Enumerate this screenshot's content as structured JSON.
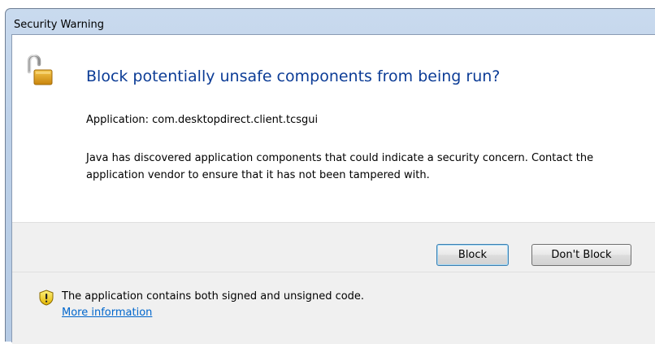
{
  "window": {
    "title": "Security Warning"
  },
  "main": {
    "heading": "Block potentially unsafe components from being run?",
    "application_line": "Application: com.desktopdirect.client.tcsgui",
    "description": "Java has discovered application components that could indicate a security concern. Contact the application vendor to ensure that it has not been tampered with."
  },
  "buttons": {
    "block_label": "Block",
    "dont_block_label": "Don't Block"
  },
  "footer": {
    "message": "The application contains both signed and unsigned code.",
    "more_info_link": "More information"
  },
  "icons": {
    "main": "padlock-icon",
    "footer": "warning-shield-icon"
  },
  "colors": {
    "heading": "#0c3c96",
    "link": "#0066cc",
    "padlock": "#e8a61c",
    "warning": "#f5d40e"
  }
}
